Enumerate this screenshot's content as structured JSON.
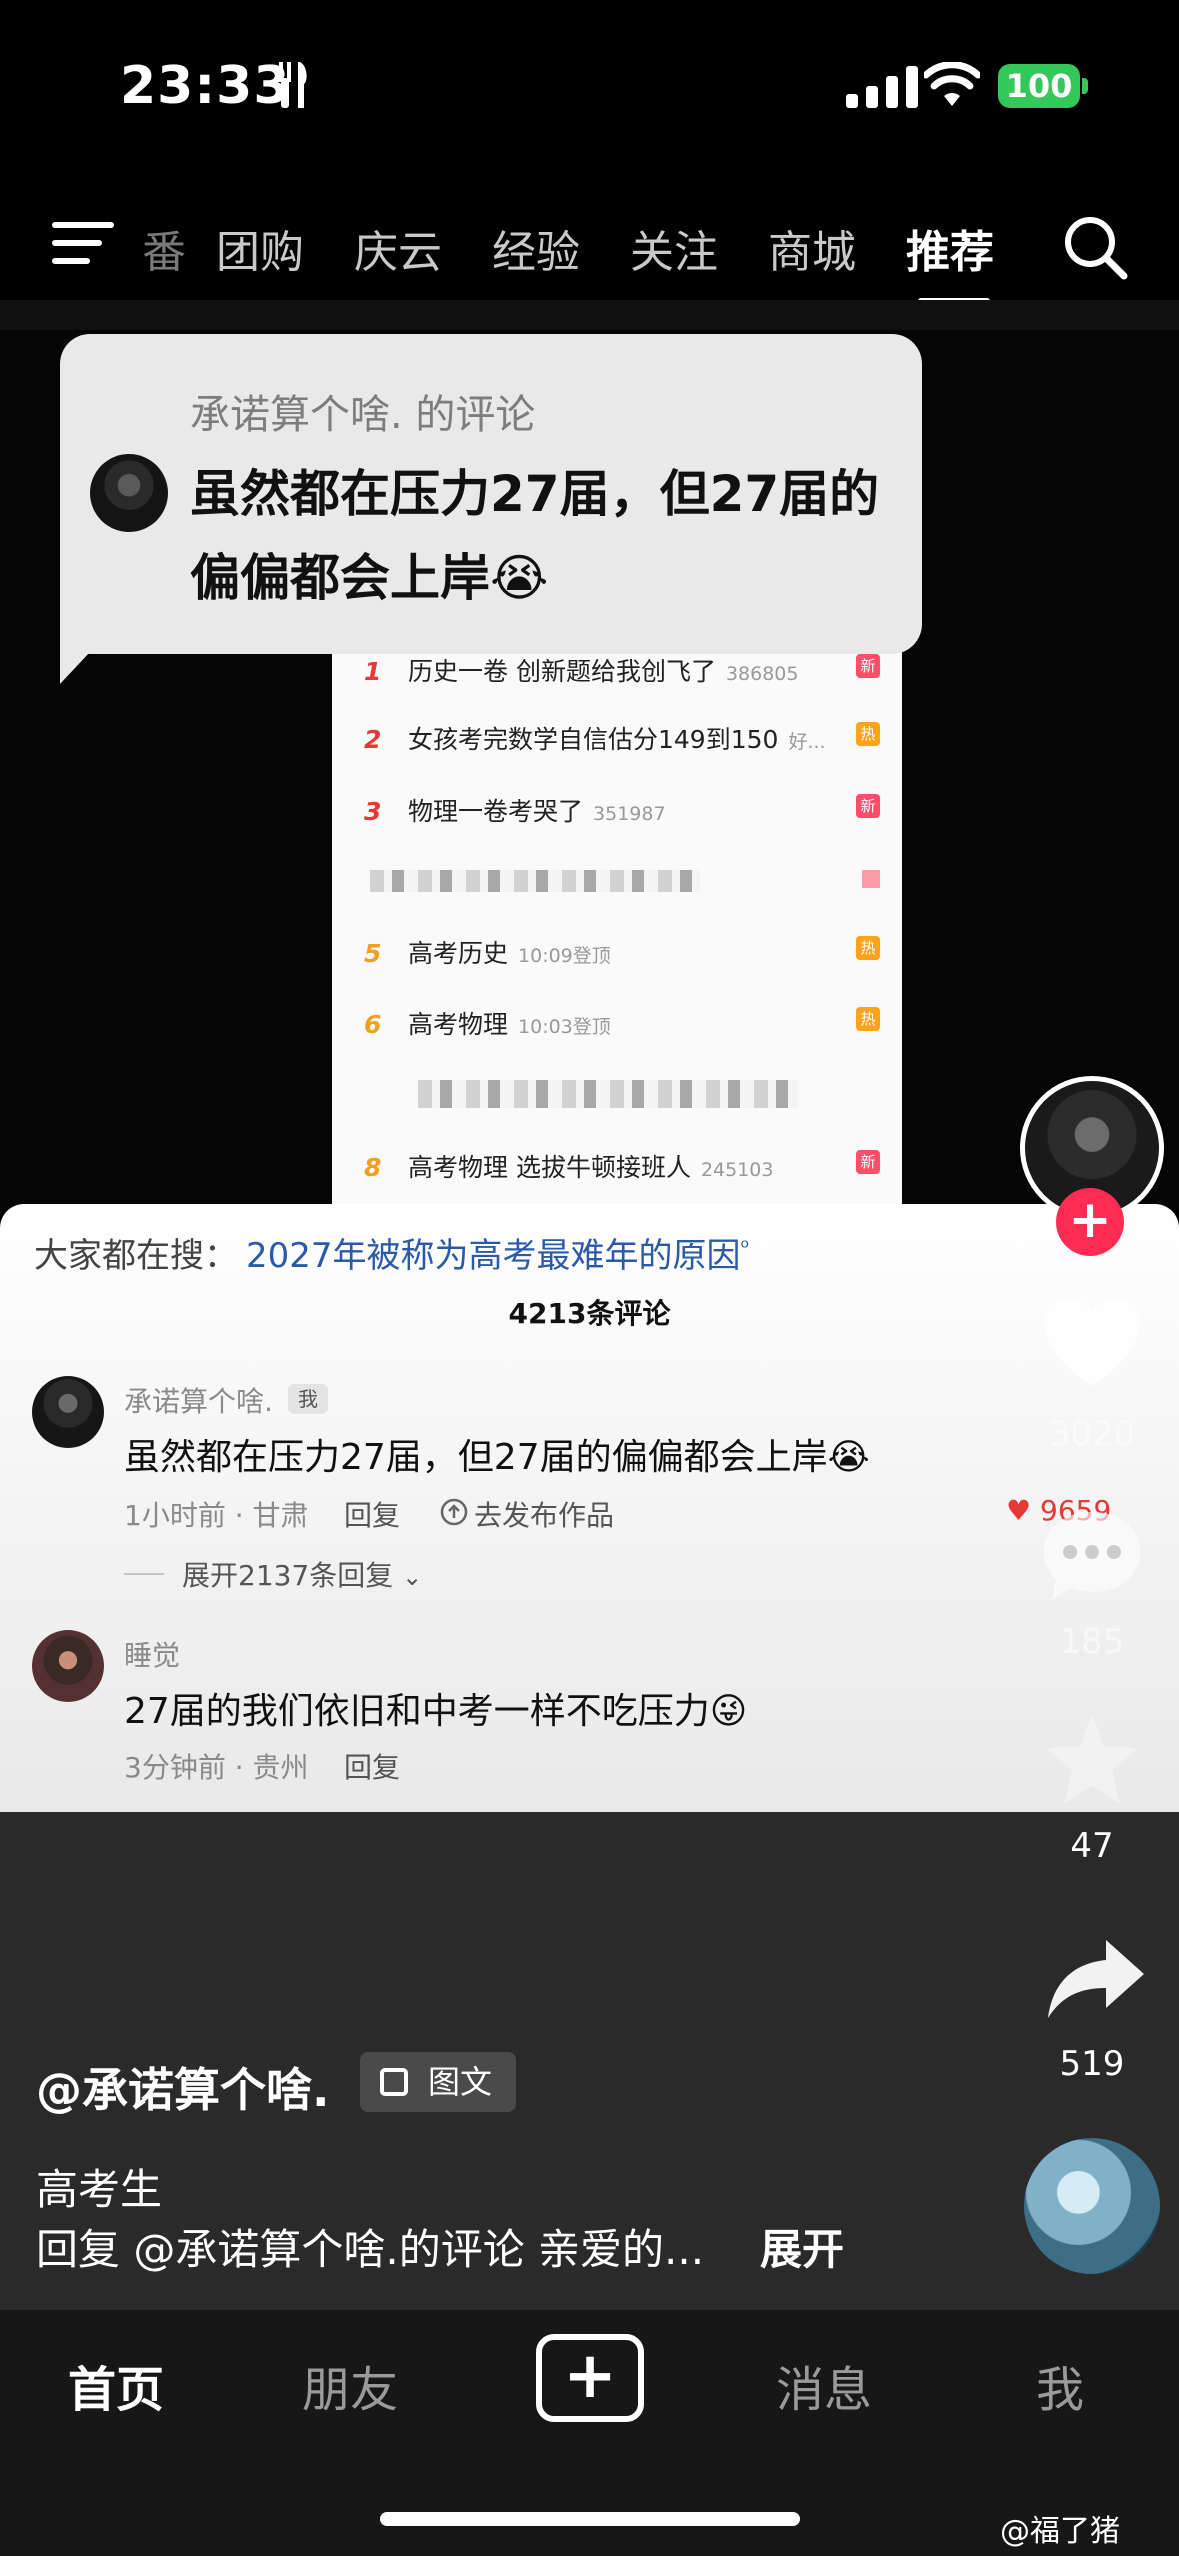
{
  "status_bar": {
    "time": "23:33",
    "battery": "100",
    "icons": [
      "utensils-icon",
      "signal-icon",
      "wifi-icon",
      "battery-icon"
    ]
  },
  "top_nav": {
    "partial_tab": "番",
    "tabs": [
      "团购",
      "庆云",
      "经验",
      "关注",
      "商城",
      "推荐"
    ],
    "active_tab": "推荐"
  },
  "bubble": {
    "user_line": "承诺算个啥. 的评论",
    "text": "虽然都在压力27届，但27届的偏偏都会上岸😭"
  },
  "hot_list": {
    "rows": [
      {
        "rank": "1",
        "title": "历史一卷 创新题给我创飞了",
        "count": "386805",
        "tag": "新"
      },
      {
        "rank": "2",
        "title": "女孩考完数学自信估分149到150",
        "count": "好...",
        "tag": "热"
      },
      {
        "rank": "3",
        "title": "物理一卷考哭了",
        "count": "351987",
        "tag": "新"
      },
      {
        "rank": "5",
        "title": "高考历史",
        "count": "10:09登顶",
        "tag": "热"
      },
      {
        "rank": "6",
        "title": "高考物理",
        "count": "10:03登顶",
        "tag": "热"
      },
      {
        "rank": "8",
        "title": "高考物理 选拔牛顿接班人",
        "count": "245103",
        "tag": "新"
      }
    ]
  },
  "comments_panel": {
    "search_hint_label": "大家都在搜：",
    "search_hint_link": "2027年被称为高考最难年的原因",
    "count": "4213条评论",
    "comments": [
      {
        "user": "承诺算个啥.",
        "badge": "我",
        "text": "虽然都在压力27届，但27届的偏偏都会上岸😭",
        "meta": "1小时前 · 甘肃",
        "reply": "回复",
        "publish": "去发布作品",
        "likes": "9659",
        "expand": "展开2137条回复"
      },
      {
        "user": "睡觉",
        "text": "27届的我们依旧和中考一样不吃压力😜",
        "meta": "3分钟前 · 贵州",
        "reply": "回复"
      }
    ]
  },
  "right_rail": {
    "likes": "3020",
    "comments": "185",
    "favorites": "47",
    "shares": "519"
  },
  "post": {
    "author": "@承诺算个啥.",
    "type_badge": "图文",
    "caption_line1": "高考生",
    "caption_line2": "回复 @承诺算个啥.的评论 亲爱的...",
    "expand": "展开"
  },
  "tab_bar": {
    "tabs": [
      "首页",
      "朋友",
      "消息",
      "我"
    ],
    "active": "首页"
  },
  "watermark": "@福了猪"
}
